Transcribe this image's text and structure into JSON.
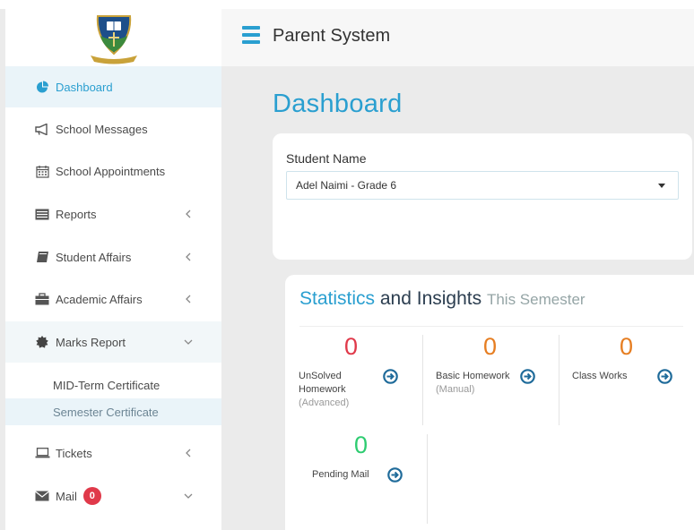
{
  "header": {
    "title": "Parent System"
  },
  "sidebar": {
    "items": [
      {
        "label": "Dashboard"
      },
      {
        "label": "School Messages"
      },
      {
        "label": "School Appointments"
      },
      {
        "label": "Reports"
      },
      {
        "label": "Student Affairs"
      },
      {
        "label": "Academic Affairs"
      },
      {
        "label": "Marks Report"
      },
      {
        "label": "Tickets"
      },
      {
        "label": "Mail",
        "badge": "0"
      }
    ],
    "marks_report_sub": [
      {
        "label": "MID-Term Certificate"
      },
      {
        "label": "Semester Certificate"
      }
    ]
  },
  "main": {
    "page_title": "Dashboard",
    "student_label": "Student Name",
    "student_selected": "Adel Naimi - Grade 6",
    "stats": {
      "title_part1": "Statistics",
      "title_part2": "and Insights",
      "title_part3": "This Semester",
      "cards": [
        {
          "value": "0",
          "label_line1": "UnSolved",
          "label_line2": "Homework",
          "sub": "(Advanced)",
          "color": "#e0394a"
        },
        {
          "value": "0",
          "label_line1": "Basic Homework",
          "sub": "(Manual)",
          "color": "#e67e22"
        },
        {
          "value": "0",
          "label_line1": "Class Works",
          "color": "#e67e22"
        },
        {
          "value": "0",
          "label_line1": "Pending Mail",
          "color": "#2ecc71"
        }
      ]
    }
  },
  "colors": {
    "accent": "#2a9fd0",
    "badge": "#e0394a",
    "go_icon": "#1f6b9a"
  }
}
